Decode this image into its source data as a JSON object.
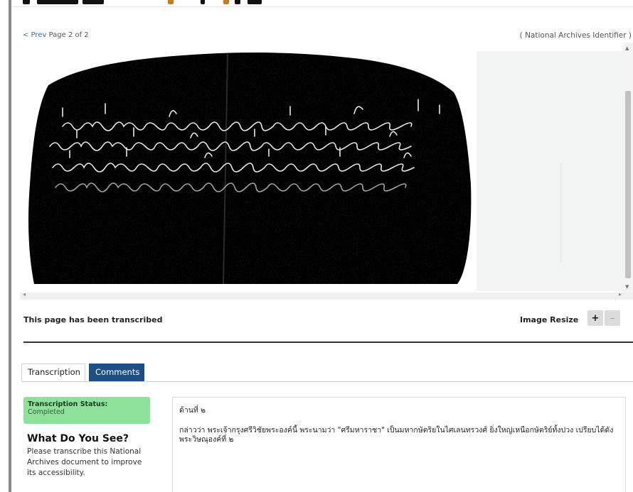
{
  "pager": {
    "prev_label": "< Prev",
    "page_text": "Page 2 of 2"
  },
  "identifier": "( National Archives Identifier )",
  "viewer": {
    "image_alt": "Stone inscription rubbing with Old Khmer/Thai script"
  },
  "status_line": "This page has been transcribed",
  "image_resize": {
    "label": "Image Resize",
    "plus": "+",
    "minus": "–"
  },
  "tabs": [
    {
      "label": "Transcription",
      "active": true
    },
    {
      "label": "Comments",
      "active": false
    }
  ],
  "transcription_status": {
    "label": "Transcription Status:",
    "value": "Completed"
  },
  "what_do_you_see": {
    "title": "What Do You See?",
    "body": "Please transcribe this National Archives document to improve its accessibility."
  },
  "transcript": {
    "line1": "ด้านที่ ๒",
    "line2": "กล่าวว่า พระเจ้ากรุงศรีวิชัยพระองค์นี้ พระนามว่า \"ศรีมหาราชา\" เป็นมหากษัตริยในไศเลนทรวงศ์ ยิ่งใหญ่เหนือกษัตริย์ทั้งปวง เปรียบได้ดังพระวิษณุองค์ที่ ๒"
  },
  "colors": {
    "tab_active_bg": "#1d4f86",
    "status_green": "#8fe09a",
    "divider": "#333333"
  }
}
